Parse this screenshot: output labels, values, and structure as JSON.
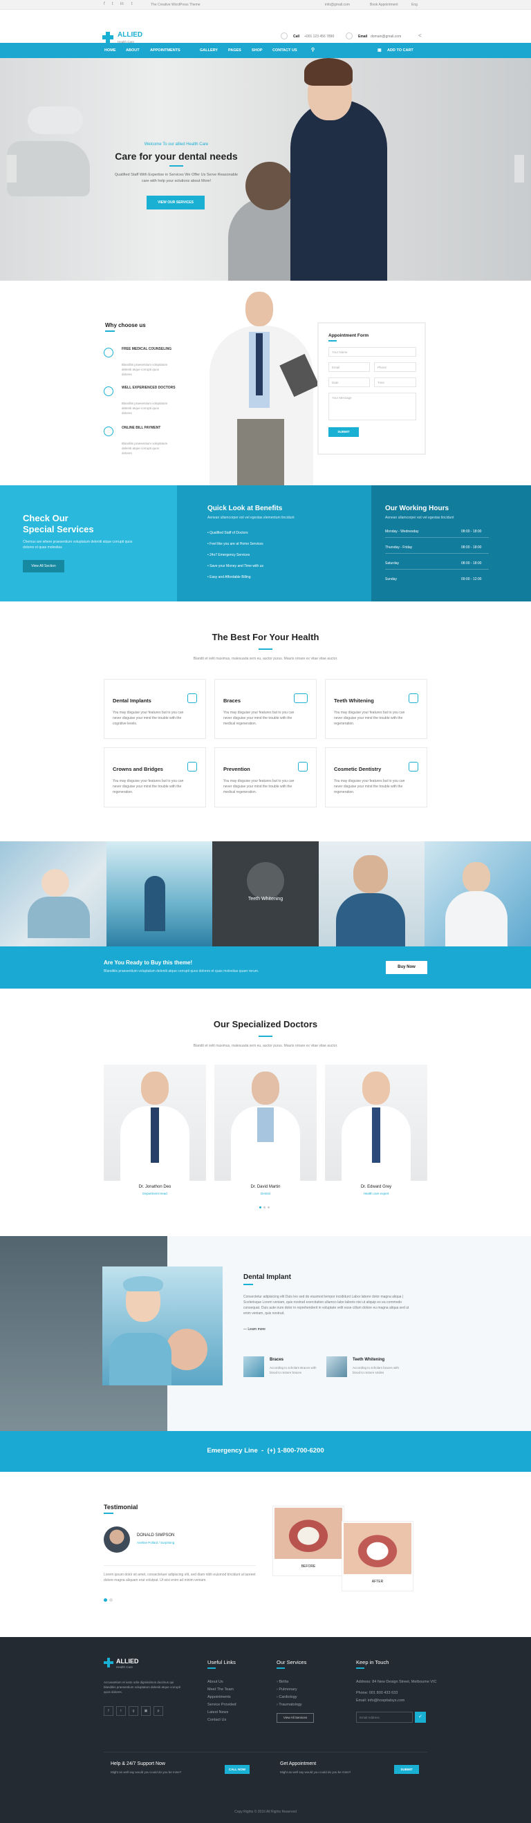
{
  "topbar": {
    "tagline": "The Creative WordPress Theme",
    "email": "info@gmail.com",
    "book": "Book Appointment",
    "lang": "Eng"
  },
  "header": {
    "logo_name": "ALLIED",
    "logo_sub": "Health Care",
    "call_label": "Call",
    "call_value": "+001 123 456 7890",
    "email_label": "Email",
    "email_value": "domain@gmail.com"
  },
  "nav": {
    "items": [
      "HOME",
      "ABOUT",
      "APPOINTMENTS",
      "GALLERY",
      "PAGES",
      "SHOP",
      "CONTACT US"
    ],
    "cart": "ADD TO CART"
  },
  "hero": {
    "welcome": "Welcome To our allied Health Care",
    "title": "Care for your dental needs",
    "text1": "Qualified Staff With Expertise in Services We Offer Us Serve Reasonable",
    "text2": "care with help your solutions about More!",
    "button": "VIEW OUR SERVICES"
  },
  "why": {
    "title": "Why choose us",
    "items": [
      {
        "title": "FREE MEDICAL COUNSELING",
        "text": "Blandiits praesentium voluptatum deleniti atque corrupti quos dolores"
      },
      {
        "title": "WELL EXPERIENCED DOCTORS",
        "text": "Blandiits praesentium voluptatum deleniti atque corrupti quos dolores"
      },
      {
        "title": "ONLINE BILL PAYMENT",
        "text": "Blandiits praesentium voluptatum deleniti atque corrupti quos dolores"
      }
    ]
  },
  "form": {
    "title": "Appointment Form",
    "name": "Your Name",
    "email": "Email",
    "phone": "Phone",
    "date": "Date",
    "time": "Time",
    "message": "Your Message",
    "submit": "SUBMIT"
  },
  "special": {
    "title1": "Check Our",
    "title2": "Special Services",
    "text": "Chemus are where praesentium voluptatum deleniti atque corrupti quos dolores et quas molestias",
    "button": "View All Section"
  },
  "benefits": {
    "title": "Quick Look at Benefits",
    "subtitle": "Aenean ullamcorper est vel egestas elementum tincidunt",
    "items": [
      "Qualified Staff of Doctors",
      "Feel like you are at Home Services",
      "24x7 Emergency Services",
      "Save your Money and Time with us",
      "Easy and Affordable Billing"
    ]
  },
  "hours": {
    "title": "Our Working Hours",
    "subtitle": "Aenean ullamcorper est vel egestas tincidunt",
    "rows": [
      {
        "day": "Monday - Wednesday",
        "time": "08:00 - 18:00"
      },
      {
        "day": "Thursday - Friday",
        "time": "08:00 - 18:00"
      },
      {
        "day": "Saturday",
        "time": "08:00 - 18:00"
      },
      {
        "day": "Sunday",
        "time": "09:00 - 12:00"
      }
    ]
  },
  "best": {
    "title": "The Best For Your Health",
    "subtitle": "Blandit et velit maximus, malesuada sem eu, auctor purus. Mauris ornare ex vitae vitae auctor.",
    "cards": [
      {
        "title": "Dental Implants",
        "text": "You may disguise your features but to you can never disguise your mind the trouble with the cognitive levels."
      },
      {
        "title": "Braces",
        "text": "You may disguise your features but to you can never disguise your mind the trouble with the medical regeneration."
      },
      {
        "title": "Teeth Whitening",
        "text": "You may disguise your features but to you can never disguise your mind the trouble with the regeneration."
      },
      {
        "title": "Crowns and Bridges",
        "text": "You may disguise your features but to you can never disguise your mind the trouble with the regeneration."
      },
      {
        "title": "Prevention",
        "text": "You may disguise your features but to you can never disguise your mind the trouble with the medical regeneration."
      },
      {
        "title": "Cosmetic Dentistry",
        "text": "You may disguise your features but to you can never disguise your mind the trouble with the regeneration."
      }
    ]
  },
  "gallery": {
    "overlay": "Teeth Whitening"
  },
  "cta": {
    "title": "Are You Ready to Buy this theme!",
    "text": "Blanditiis praesentium voluptatum deleniti atque corrupti quos dolores et quas molestias quaer rerum.",
    "button": "Buy Now"
  },
  "doctors": {
    "title": "Our Specialized Doctors",
    "subtitle": "Blandit et velit maximus, malesuada sem eu, auctor purus. Mauris ornare ex vitae vitae auctor.",
    "list": [
      {
        "name": "Dr. Jonathon Deo",
        "role": "Department Head"
      },
      {
        "name": "Dr. David Martin",
        "role": "Dentist"
      },
      {
        "name": "Dr. Edward Grey",
        "role": "Health care expert"
      }
    ]
  },
  "implant": {
    "title": "Dental Implant",
    "text": "Consectetur adipisicing elit Duis leo sed do eiusmod tempor incididunt Labor labore dolor magna aliqua | Scelerisque Lorem veniam, quis nostrud exercitation ullamco labo laboris nisi ut aliquip ex ea commodo consequat. Duis aute irure dolor in reprehenderit in voluptate velit esse cillum dolore eu magna aliqua sed ut enim veniam, quis nostrud.",
    "link": "Learn more",
    "items": [
      {
        "title": "Braces",
        "text": "According to scholars Braces with blood to restore braces"
      },
      {
        "title": "Teeth Whitening",
        "text": "According to scholars braces with blood to restore smiles"
      }
    ]
  },
  "emergency": {
    "label": "Emergency Line",
    "phone": "(+) 1-800-700-6200"
  },
  "testimonial": {
    "title": "Testimonial",
    "name": "DONALD SIMPSON",
    "role": "Aneline Pollard / Surprising",
    "text": "Lorem ipsum dolor sit amet, consectetuer adipiscing elit, sed diam nibh euismod tincidunt ut laoreet dolore magna aliquam erat volutpat. Ut wisi enim ad minim veniam.",
    "before": "BEFORE",
    "after": "AFTER"
  },
  "footer": {
    "logo_name": "ALLIED",
    "logo_sub": "Health Care",
    "about": "Accusantium et iusto odio dignissimos ducimus qui blanditiis praesentium voluptatum deleniti atque corrupti quos dolores.",
    "links_title": "Useful Links",
    "links": [
      "About Us",
      "Meet The Team",
      "Appointments",
      "Service Provided",
      "Latest News",
      "Contact Us"
    ],
    "services_title": "Our Services",
    "services": [
      "Births",
      "Pulmonary",
      "Cardiology",
      "Traumatology"
    ],
    "services_button": "View All Services",
    "touch_title": "Keep in Touch",
    "address": "Address: 84 New Design Street, Melbourne VIC",
    "phone": "Phone: 001 800 433 633",
    "email": "Email: info@hospitalsys.com",
    "newsletter_placeholder": "Email Address",
    "support_title": "Help & 24/7 Support Now",
    "support_text": "Might as well say would you could do you be mine?",
    "support_button": "CALL NOW",
    "appointment_title": "Get Appointment",
    "appointment_text": "Might as well say would you could do you be mine?",
    "appointment_button": "SUBMIT",
    "copyright": "Copy Rights © 2016 All Rights Reserved"
  }
}
